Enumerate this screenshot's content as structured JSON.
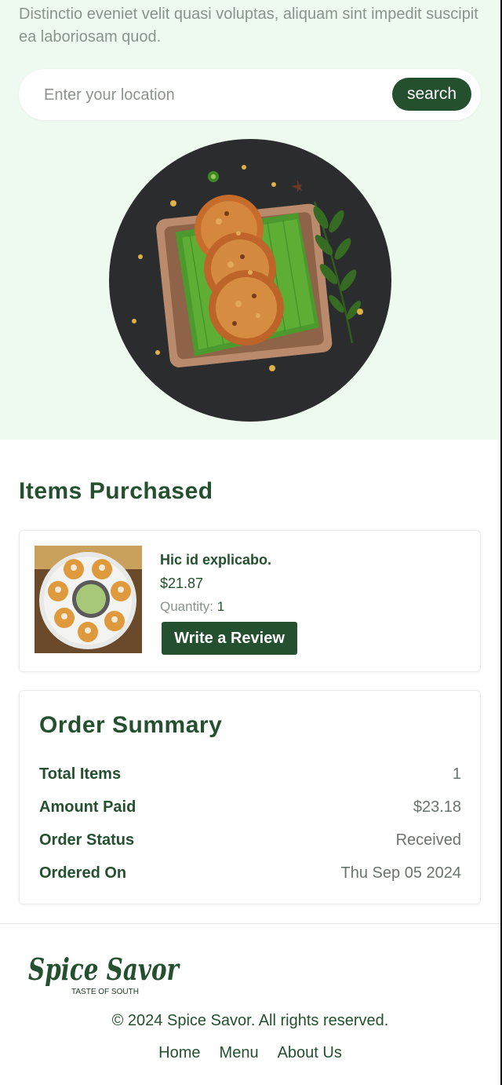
{
  "hero": {
    "description": "Distinctio eveniet velit quasi voluptas, aliquam sint impedit suscipit ea laboriosam quod.",
    "search_placeholder": "Enter your location",
    "search_button": "search",
    "image": "circular plate with fried vada on banana leaf"
  },
  "items_section": {
    "title": "Items Purchased",
    "items": [
      {
        "name": "Hic id explicabo.",
        "price": "$21.87",
        "quantity_label": "Quantity:",
        "quantity_value": "1",
        "review_button": "Write a Review",
        "image": "plate of pani puri with green chutney"
      }
    ]
  },
  "order_summary": {
    "title": "Order Summary",
    "rows": [
      {
        "label": "Total Items",
        "value": "1"
      },
      {
        "label": "Amount Paid",
        "value": "$23.18"
      },
      {
        "label": "Order Status",
        "value": "Received"
      },
      {
        "label": "Ordered On",
        "value": "Thu Sep 05 2024"
      }
    ]
  },
  "footer": {
    "logo_text": "Spice Savor",
    "logo_tagline": "TASTE OF SOUTH",
    "copyright": "© 2024 Spice Savor. All rights reserved.",
    "links": [
      "Home",
      "Menu",
      "About Us"
    ]
  },
  "colors": {
    "brand_green": "#24502f",
    "hero_background": "#eef9ef",
    "muted_text": "#8a948c"
  }
}
